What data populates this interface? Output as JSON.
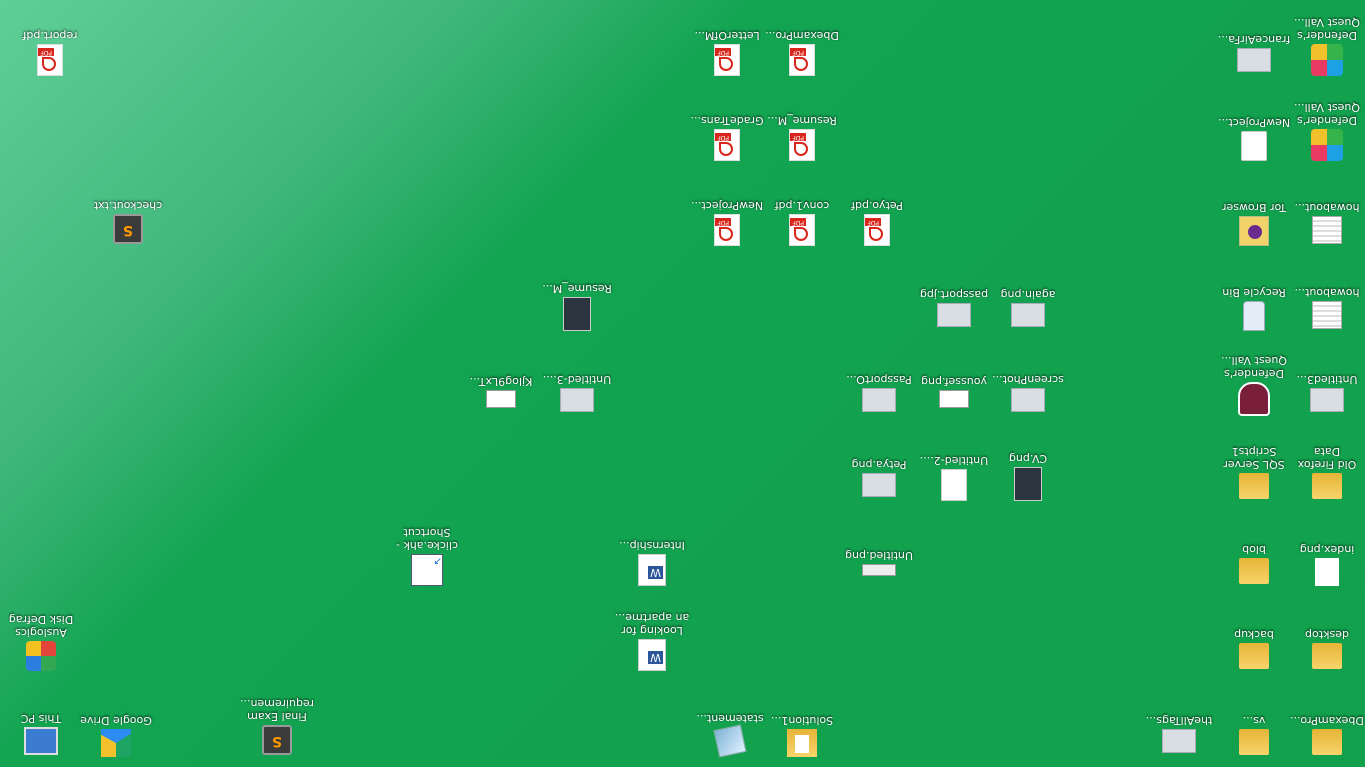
{
  "desktop": {
    "icons": [
      {
        "label": "This PC",
        "icon": "pc-icon"
      },
      {
        "label": "Google Drive",
        "icon": "google-drive-icon"
      },
      {
        "label": "Final Exam requiremen...",
        "icon": "sublime-icon"
      },
      {
        "label": "statement...",
        "icon": "statement-icon"
      },
      {
        "label": "Solution1...",
        "icon": "folder-doc-icon"
      },
      {
        "label": "theAllTags...",
        "icon": "image-icon"
      },
      {
        "label": "vs...",
        "icon": "folder-icon"
      },
      {
        "label": "DbexamPro...",
        "icon": "folder-icon"
      },
      {
        "label": "Auslogics Disk Defrag",
        "icon": "defrag-icon"
      },
      {
        "label": "Looking for an apartme...",
        "icon": "word-icon"
      },
      {
        "label": "backup",
        "icon": "folder-icon"
      },
      {
        "label": "desktop",
        "icon": "folder-icon"
      },
      {
        "label": "clicke.ahk - Shortcut",
        "icon": "shortcut-icon"
      },
      {
        "label": "Internship...",
        "icon": "word-icon"
      },
      {
        "label": "Untitled.png",
        "icon": "image-icon"
      },
      {
        "label": "blob",
        "icon": "folder-icon"
      },
      {
        "label": "index.png",
        "icon": "image-icon"
      },
      {
        "label": "Petya.png",
        "icon": "image-icon"
      },
      {
        "label": "Untitled-2....",
        "icon": "image-icon"
      },
      {
        "label": "CV.png",
        "icon": "image-icon"
      },
      {
        "label": "SQL Server Scripts1",
        "icon": "folder-icon"
      },
      {
        "label": "Old Firefox Data",
        "icon": "folder-icon"
      },
      {
        "label": "KjIog9LxT...",
        "icon": "image-icon"
      },
      {
        "label": "Untitled-3....",
        "icon": "image-icon"
      },
      {
        "label": "PassportO...",
        "icon": "image-icon"
      },
      {
        "label": "youssef.png",
        "icon": "image-icon"
      },
      {
        "label": "screenPhot...",
        "icon": "image-icon"
      },
      {
        "label": "Defender's Quest Vall...",
        "icon": "shield-icon"
      },
      {
        "label": "Untitled3...",
        "icon": "image-icon"
      },
      {
        "label": "Resume_M...",
        "icon": "image-icon"
      },
      {
        "label": "passport.jpg",
        "icon": "image-icon"
      },
      {
        "label": "again.png",
        "icon": "image-icon"
      },
      {
        "label": "Recycle Bin",
        "icon": "recycle-bin-icon"
      },
      {
        "label": "howabout...",
        "icon": "image-icon"
      },
      {
        "label": "checkout.txt",
        "icon": "sublime-icon"
      },
      {
        "label": "NewProject...",
        "icon": "pdf-icon"
      },
      {
        "label": "conv1.pdf",
        "icon": "pdf-icon"
      },
      {
        "label": "Petyo.pdf",
        "icon": "pdf-icon"
      },
      {
        "label": "Tor Browser",
        "icon": "tor-icon"
      },
      {
        "label": "howabout...",
        "icon": "image-icon"
      },
      {
        "label": "GradeTrans...",
        "icon": "pdf-icon"
      },
      {
        "label": "Resume_M...",
        "icon": "pdf-icon"
      },
      {
        "label": "NewProject...",
        "icon": "cat-icon"
      },
      {
        "label": "Defender's Quest Vall...",
        "icon": "tri-icon"
      },
      {
        "label": "report.pdf",
        "icon": "pdf-icon"
      },
      {
        "label": "LetterOfM...",
        "icon": "pdf-icon"
      },
      {
        "label": "DbexamPro...",
        "icon": "pdf-icon"
      },
      {
        "label": "franceAirFa...",
        "icon": "image-icon"
      },
      {
        "label": "Defender's Quest Vall...",
        "icon": "tri-icon"
      }
    ]
  }
}
